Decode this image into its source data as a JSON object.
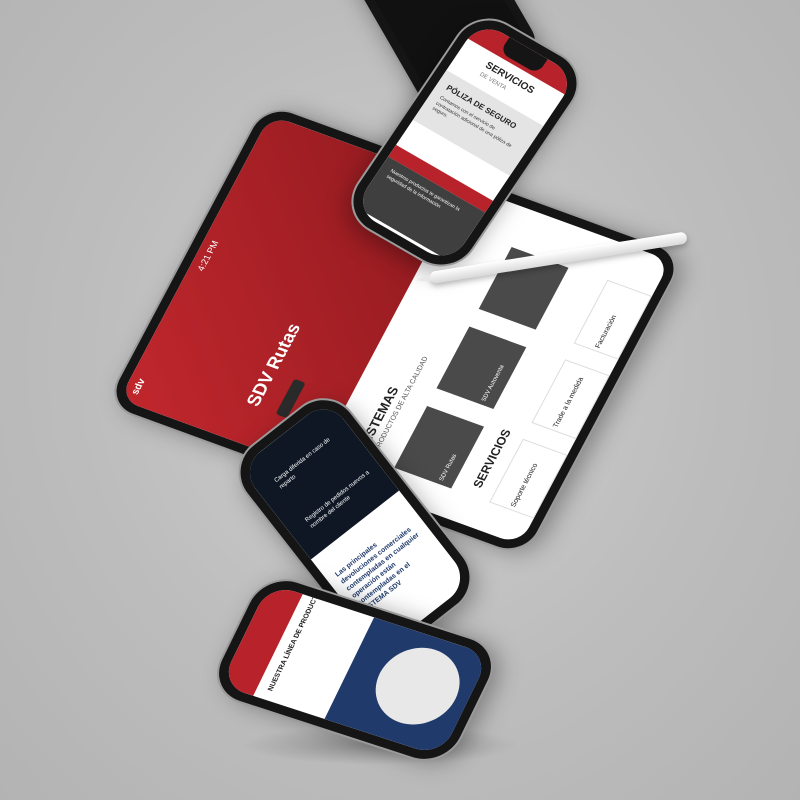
{
  "tablet": {
    "status_time": "4:21 PM",
    "brand": "sdv",
    "hero_title": "SDV Rutas",
    "systems_title": "SISTEMAS",
    "systems_subtitle": "PRODUCTOS DE ALTA CALIDAD",
    "services_title": "SERVICIOS",
    "tiles": [
      "SDV Rutas",
      "SDV Autoventa",
      "Facturación",
      "Trade a la medida",
      "Soporte técnico"
    ]
  },
  "phone_top": {
    "services_title": "SERVICIOS",
    "services_subtitle": "DE VENTA",
    "policy_title": "PÓLIZA DE SEGURO",
    "policy_text": "Contamos con el servicio de contratación adicional de una póliza de seguro.",
    "banner_text": "Nuestros productos te garantizan la seguridad de la información"
  },
  "phone_middle": {
    "card1": "Carga diferida en caso de reparto",
    "card2": "Registro de pedidos nuevos a nombre del cliente",
    "headline": "Las principales devoluciones comerciales contempladas en cualquier operación están contempladas en el SISTEMA SDV"
  },
  "phone_bottom": {
    "heading": "NUESTRA LÍNEA DE PRODUCTOS"
  },
  "colors": {
    "red": "#b8232b",
    "dark": "#3f3f3f",
    "navy": "#1f3a6b"
  }
}
